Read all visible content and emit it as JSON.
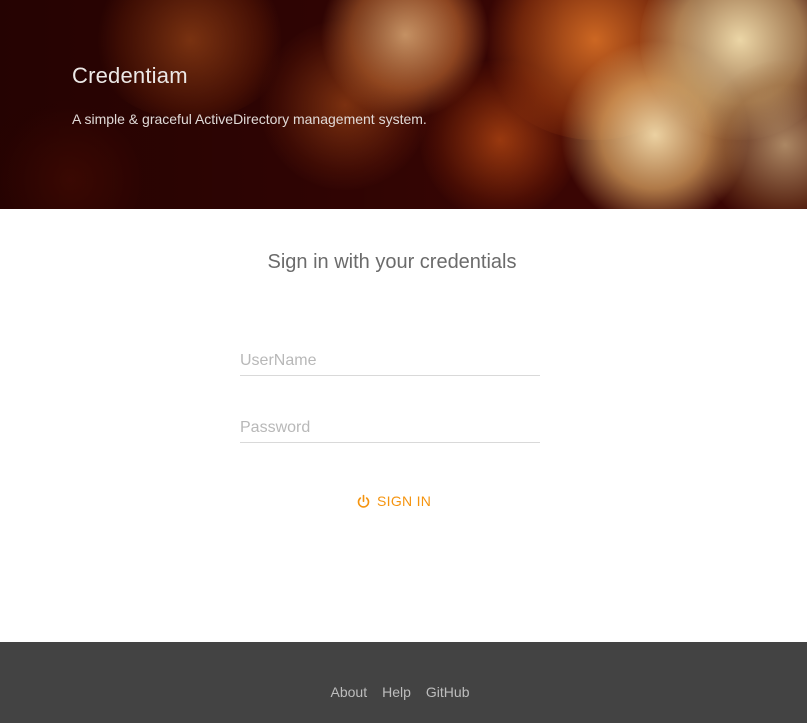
{
  "header": {
    "title": "Credentiam",
    "subtitle": "A simple & graceful ActiveDirectory management system."
  },
  "login": {
    "heading": "Sign in with your credentials",
    "username_placeholder": "UserName",
    "password_placeholder": "Password",
    "signin_label": "SIGN IN",
    "signin_icon": "power-icon"
  },
  "footer": {
    "links": [
      "About",
      "Help",
      "GitHub"
    ]
  },
  "colors": {
    "accent": "#f5940f",
    "footer_bg": "#434343",
    "hero_bg": "#3a0604"
  }
}
